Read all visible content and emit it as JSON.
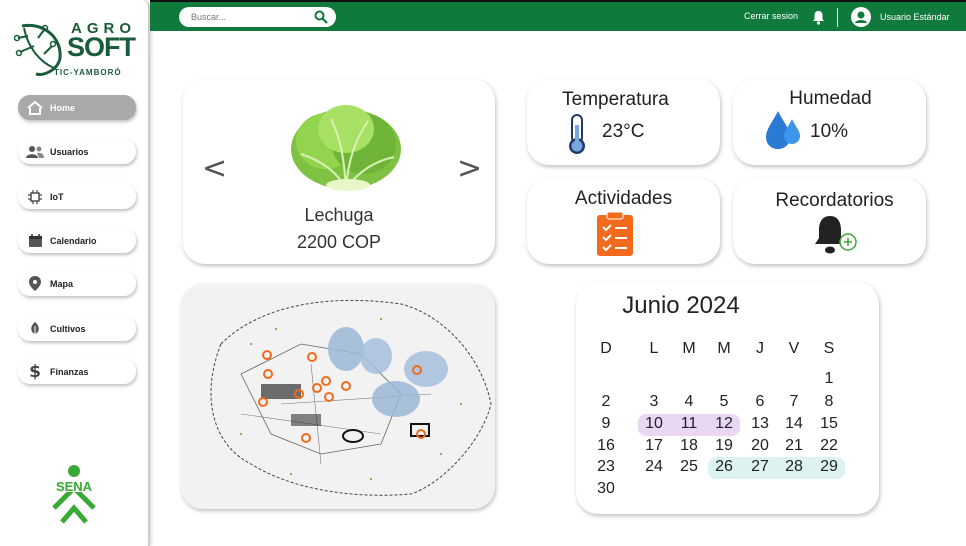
{
  "header": {
    "search_placeholder": "Buscar...",
    "logout_label": "Cerrar sesion",
    "user_name": "Usuario Estándar"
  },
  "brand": {
    "logo_top": "AGRO",
    "logo_main": "SOFT",
    "logo_sub": "TIC-YAMBORÓ",
    "partner_logo": "SENA",
    "accent_color": "#0f7a3c"
  },
  "sidebar": {
    "items": [
      {
        "label": "Home",
        "icon": "home-icon",
        "active": true
      },
      {
        "label": "Usuarios",
        "icon": "users-icon",
        "active": false
      },
      {
        "label": "IoT",
        "icon": "chip-icon",
        "active": false
      },
      {
        "label": "Calendario",
        "icon": "calendar-icon",
        "active": false
      },
      {
        "label": "Mapa",
        "icon": "map-pin-icon",
        "active": false
      },
      {
        "label": "Cultivos",
        "icon": "leaf-icon",
        "active": false
      },
      {
        "label": "Finanzas",
        "icon": "dollar-icon",
        "active": false
      }
    ]
  },
  "product": {
    "name": "Lechuga",
    "price": "2200 COP",
    "prev_label": "<",
    "next_label": ">"
  },
  "widgets": {
    "temperature": {
      "title": "Temperatura",
      "value": "23°C",
      "icon": "thermometer-icon"
    },
    "humidity": {
      "title": "Humedad",
      "value": "10%",
      "icon": "water-drops-icon"
    },
    "activities": {
      "title": "Actividades",
      "icon": "clipboard-checklist-icon"
    },
    "reminders": {
      "title": "Recordatorios",
      "icon": "bell-plus-icon"
    }
  },
  "calendar": {
    "title": "Junio 2024",
    "weekdays": [
      "D",
      "L",
      "M",
      "M",
      "J",
      "V",
      "S"
    ],
    "weeks": [
      [
        "",
        "",
        "",
        "",
        "",
        "",
        "1"
      ],
      [
        "2",
        "3",
        "4",
        "5",
        "6",
        "7",
        "8"
      ],
      [
        "9",
        "10",
        "11",
        "12",
        "13",
        "14",
        "15"
      ],
      [
        "16",
        "17",
        "18",
        "19",
        "20",
        "21",
        "22"
      ],
      [
        "23",
        "24",
        "25",
        "26",
        "27",
        "28",
        "29"
      ],
      [
        "30",
        "",
        "",
        "",
        "",
        "",
        ""
      ]
    ],
    "highlight_purple": [
      "10",
      "11",
      "12"
    ],
    "highlight_teal": [
      "26",
      "27",
      "28",
      "29"
    ],
    "purple_color": "#ead7f3",
    "teal_color": "#dcf3f1"
  }
}
